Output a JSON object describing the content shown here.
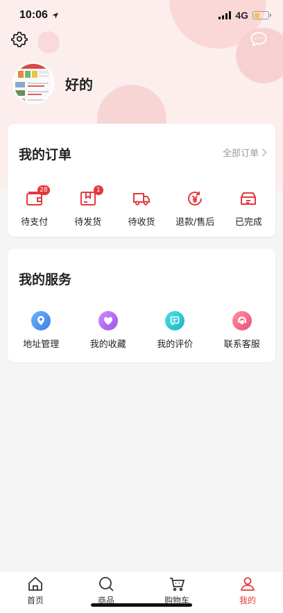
{
  "status_bar": {
    "time": "10:06",
    "network": "4G"
  },
  "profile": {
    "nickname": "好的"
  },
  "orders": {
    "title": "我的订单",
    "all_label": "全部订单",
    "items": [
      {
        "label": "待支付",
        "icon": "wallet-icon",
        "badge": "28"
      },
      {
        "label": "待发货",
        "icon": "package-icon",
        "badge": "1"
      },
      {
        "label": "待收货",
        "icon": "truck-icon",
        "badge": ""
      },
      {
        "label": "退款/售后",
        "icon": "refund-icon",
        "badge": ""
      },
      {
        "label": "已完成",
        "icon": "box-check-icon",
        "badge": ""
      }
    ]
  },
  "services": {
    "title": "我的服务",
    "items": [
      {
        "label": "地址管理",
        "icon": "location-icon",
        "color": "#4a8ef5"
      },
      {
        "label": "我的收藏",
        "icon": "heart-icon",
        "color": "#b56cf0"
      },
      {
        "label": "我的评价",
        "icon": "comment-icon",
        "color": "#29c6d9"
      },
      {
        "label": "联系客服",
        "icon": "service-icon",
        "color": "#f26b8a"
      }
    ]
  },
  "tabbar": {
    "items": [
      {
        "label": "首页",
        "icon": "home-icon",
        "active": false
      },
      {
        "label": "商品",
        "icon": "search-icon",
        "active": false
      },
      {
        "label": "购物车",
        "icon": "cart-icon",
        "active": false
      },
      {
        "label": "我的",
        "icon": "user-icon",
        "active": true
      }
    ]
  },
  "colors": {
    "accent": "#e5383b",
    "hero_bg": "#fdeeee"
  }
}
